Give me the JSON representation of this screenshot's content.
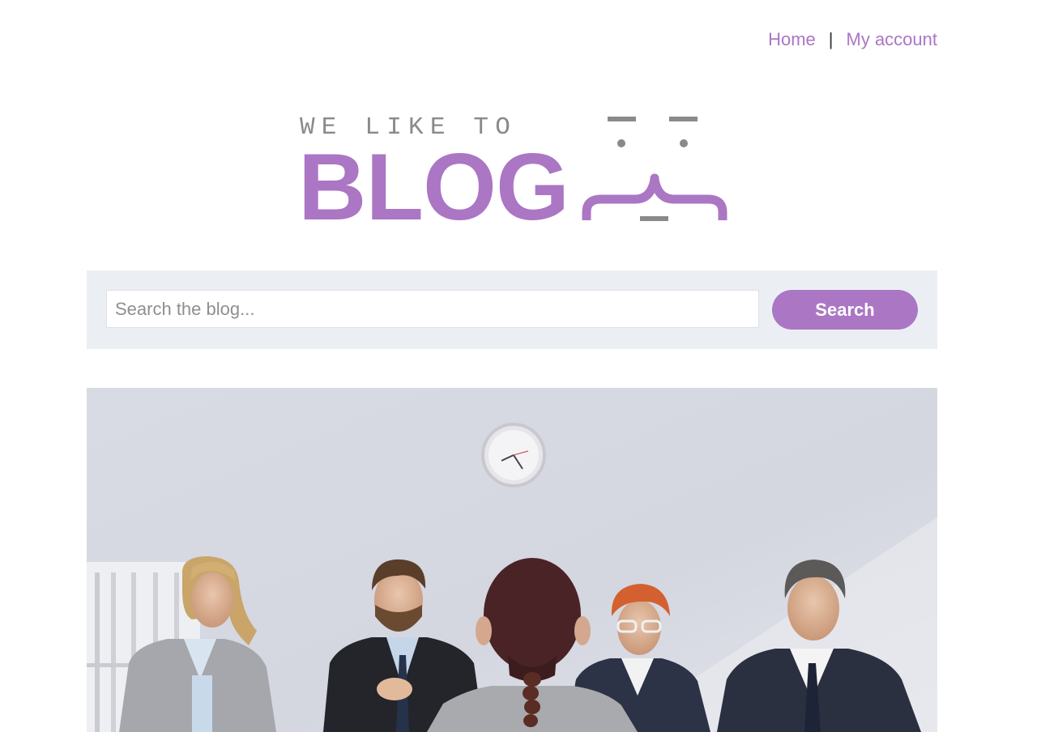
{
  "nav": {
    "home_label": "Home",
    "separator": "|",
    "account_label": "My account"
  },
  "logo": {
    "tagline": "WE LIKE TO",
    "wordmark": "BLOG"
  },
  "search": {
    "placeholder": "Search the blog...",
    "button_label": "Search"
  },
  "hero": {
    "subject": "job interview panel photo"
  },
  "colors": {
    "accent": "#ab76c4",
    "logo_gray": "#8a8a8a",
    "search_bg": "#ebeff3"
  }
}
